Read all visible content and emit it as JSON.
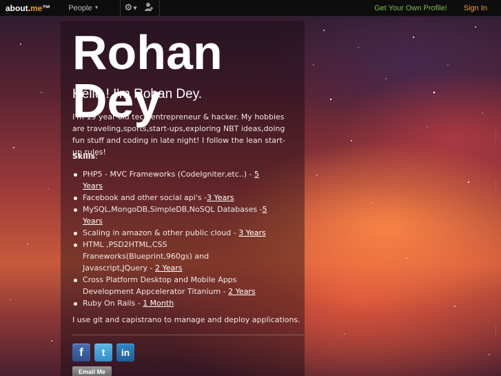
{
  "nav": {
    "logo_prefix": "about.",
    "logo_me": "me",
    "logo_tm": "™",
    "people_label": "People",
    "get_own_profile": "Get Your Own Profile!",
    "sign_in": "Sign In"
  },
  "profile": {
    "name": "Rohan Dey",
    "headline": "Hello ! I'm Rohan Dey.",
    "bio": "I'm 19 year old tech entrepreneur & hacker. My hobbies are traveling,sports,start-ups,exploring NBT ideas,doing fun stuff and coding in late night! I follow the lean start-up rules!",
    "skills_heading": "Skills",
    "skills_colon": ":",
    "skills": [
      {
        "text": "PHP5  - MVC Frameworks (CodeIgniter,etc..) - ",
        "link": "5 Years"
      },
      {
        "text": "Facebook and other social api's  -",
        "link": "3 Years"
      },
      {
        "text": "MySQL,MongoDB,SimpleDB,NoSQL Databases -",
        "link": "5 Years"
      },
      {
        "text": "Scaling in amazon & other public cloud - ",
        "link": "3 Years "
      },
      {
        "text": "HTML ,PSD2HTML,CSS Franeworks(Blueprint,960gs) and Javascript,JQuery - ",
        "link": "2 Years"
      },
      {
        "text": "Cross Platform Desktop and Mobile Apps Development Appcelerator Titanium - ",
        "link": "2 Years"
      },
      {
        "text": "Ruby On Rails - ",
        "link": "1 Month"
      }
    ],
    "tools_line": "I use git and capistrano to manage and deploy applications.",
    "social": {
      "facebook": "f",
      "twitter": "t",
      "linkedin": "in"
    },
    "email_button": "Email Me"
  },
  "icons": {
    "gear": "gear-icon",
    "user": "user-icon",
    "caret": "chevron-down-icon"
  }
}
